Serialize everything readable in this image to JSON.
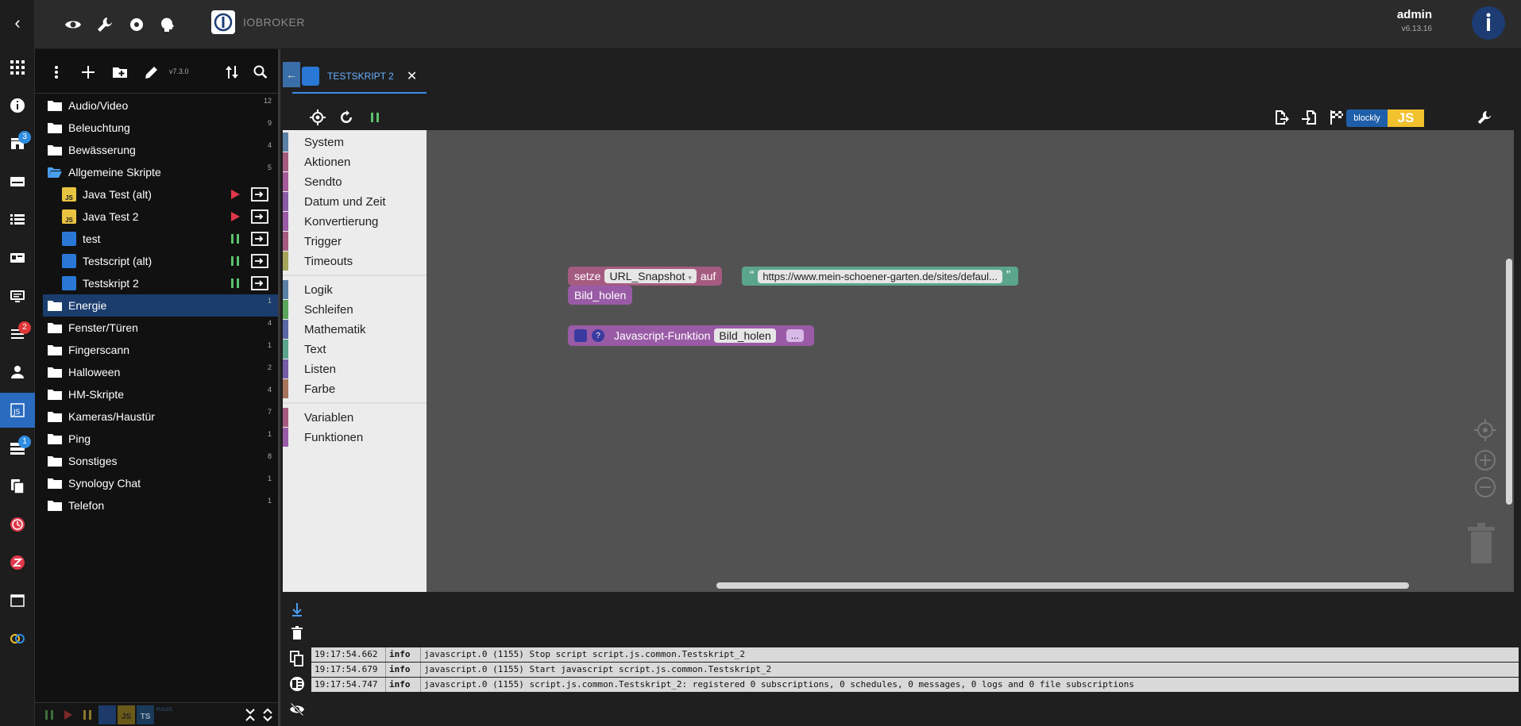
{
  "header": {
    "logo_text": "IOBROKER",
    "user_name": "admin",
    "version": "v6.13.16"
  },
  "rail": {
    "badges": {
      "adapters": "3",
      "logs": "2",
      "instances": "1"
    }
  },
  "tree": {
    "version": "v7.3.0",
    "folders": [
      {
        "name": "Audio/Video",
        "count": "12"
      },
      {
        "name": "Beleuchtung",
        "count": "9"
      },
      {
        "name": "Bewässerung",
        "count": "4"
      },
      {
        "name": "Allgemeine Skripte",
        "count": "5"
      }
    ],
    "scripts": [
      {
        "name": "Java Test (alt)",
        "type": "JS"
      },
      {
        "name": "Java Test 2",
        "type": "JS"
      },
      {
        "name": "test",
        "type": ""
      },
      {
        "name": "Testscript (alt)",
        "type": ""
      },
      {
        "name": "Testskript 2",
        "type": ""
      }
    ],
    "folders2": [
      {
        "name": "Energie",
        "count": "1"
      },
      {
        "name": "Fenster/Türen",
        "count": "4"
      },
      {
        "name": "Fingerscann",
        "count": "1"
      },
      {
        "name": "Halloween",
        "count": "2"
      },
      {
        "name": "HM-Skripte",
        "count": "4"
      },
      {
        "name": "Kameras/Haustür",
        "count": "7"
      },
      {
        "name": "Ping",
        "count": "1"
      },
      {
        "name": "Sonstiges",
        "count": "8"
      },
      {
        "name": "Synology Chat",
        "count": "1"
      },
      {
        "name": "Telefon",
        "count": "1"
      }
    ],
    "bottom_labels": {
      "js": "JS",
      "ts": "TS",
      "rules": "RULES"
    }
  },
  "editor": {
    "tab_label": "TESTSKRIPT 2",
    "toggle_left": "blockly",
    "toggle_right": "JS",
    "categories_a": [
      {
        "name": "System",
        "color": "#5b80a5"
      },
      {
        "name": "Aktionen",
        "color": "#a55b80"
      },
      {
        "name": "Sendto",
        "color": "#a55b99"
      },
      {
        "name": "Datum und Zeit",
        "color": "#8a5ba5"
      },
      {
        "name": "Konvertierung",
        "color": "#995ba5"
      },
      {
        "name": "Trigger",
        "color": "#a55b80"
      },
      {
        "name": "Timeouts",
        "color": "#a5a55b"
      }
    ],
    "categories_b": [
      {
        "name": "Logik",
        "color": "#5b80a5"
      },
      {
        "name": "Schleifen",
        "color": "#5ba55b"
      },
      {
        "name": "Mathematik",
        "color": "#5b67a5"
      },
      {
        "name": "Text",
        "color": "#5ba58c"
      },
      {
        "name": "Listen",
        "color": "#745ba5"
      },
      {
        "name": "Farbe",
        "color": "#a5745b"
      }
    ],
    "categories_c": [
      {
        "name": "Variablen",
        "color": "#a55b80"
      },
      {
        "name": "Funktionen",
        "color": "#995ba5"
      }
    ],
    "blocks": {
      "set_label": "setze",
      "set_var": "URL_Snapshot",
      "set_to": "auf",
      "url_value": "https://www.mein-schoener-garten.de/sites/defaul...",
      "call_name": "Bild_holen",
      "func_label": "Javascript-Funktion",
      "func_name": "Bild_holen",
      "func_more": "..."
    }
  },
  "log": [
    {
      "time": "19:17:54.662",
      "level": "info",
      "msg": "javascript.0 (1155) Stop script script.js.common.Testskript_2"
    },
    {
      "time": "19:17:54.679",
      "level": "info",
      "msg": "javascript.0 (1155) Start javascript script.js.common.Testskript_2"
    },
    {
      "time": "19:17:54.747",
      "level": "info",
      "msg": "javascript.0 (1155) script.js.common.Testskript_2: registered 0 subscriptions, 0 schedules, 0 messages, 0 logs and 0 file subscriptions"
    }
  ]
}
